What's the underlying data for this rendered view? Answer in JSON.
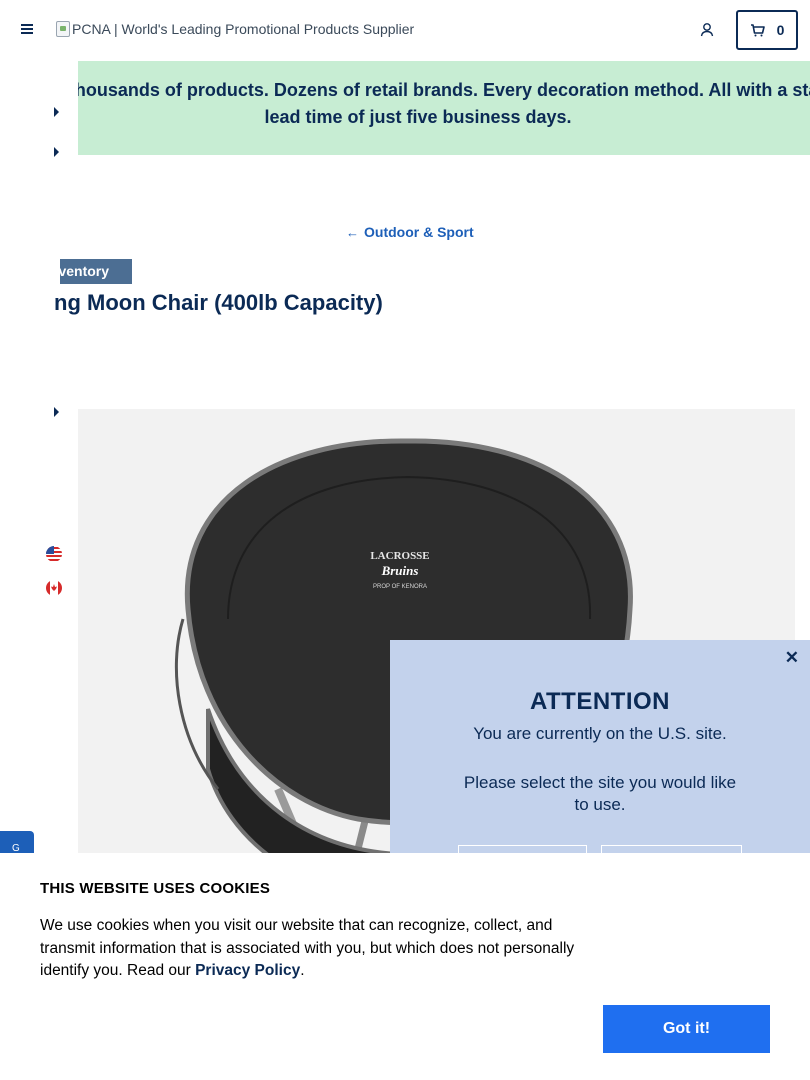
{
  "header": {
    "logo_alt": "PCNA | World's Leading Promotional Products Supplier",
    "cart_count": "0"
  },
  "promo": {
    "text": "Why Wait? Thousands of products. Dozens of retail brands. Every decoration method. All with a standard lead time of just five business days."
  },
  "breadcrumb": {
    "label": "Outdoor & Sport"
  },
  "product": {
    "stock_tag": "Inventory",
    "title": "ng Moon Chair (400lb Capacity)",
    "image_print": {
      "line1": "LACROSSE",
      "line2": "Bruins",
      "line3": "PROP OF KENORA"
    }
  },
  "feedback": {
    "label": "G"
  },
  "modal": {
    "title": "ATTENTION",
    "line1": "You are currently on the U.S. site.",
    "line2": "Please select the site you would like to use."
  },
  "cookie_banner": {
    "title": "THIS WEBSITE USES COOKIES",
    "text": "We use cookies when you visit our website that can recognize, collect, and transmit information that is associated with you, but which does not personally identify you. Read our ",
    "link_label": "Privacy Policy",
    "text_end": ".",
    "button_label": "Got it!"
  },
  "colors": {
    "navy": "#0b2a55",
    "promo_bg": "#c7edd3",
    "modal_bg": "#c3d2ec",
    "accent_blue": "#1f6ff0",
    "link_blue": "#1d5fb8"
  },
  "icons": [
    "menu-icon",
    "user-icon",
    "cart-icon",
    "arrow-left-icon",
    "us-flag-icon",
    "canada-flag-icon",
    "close-icon"
  ]
}
